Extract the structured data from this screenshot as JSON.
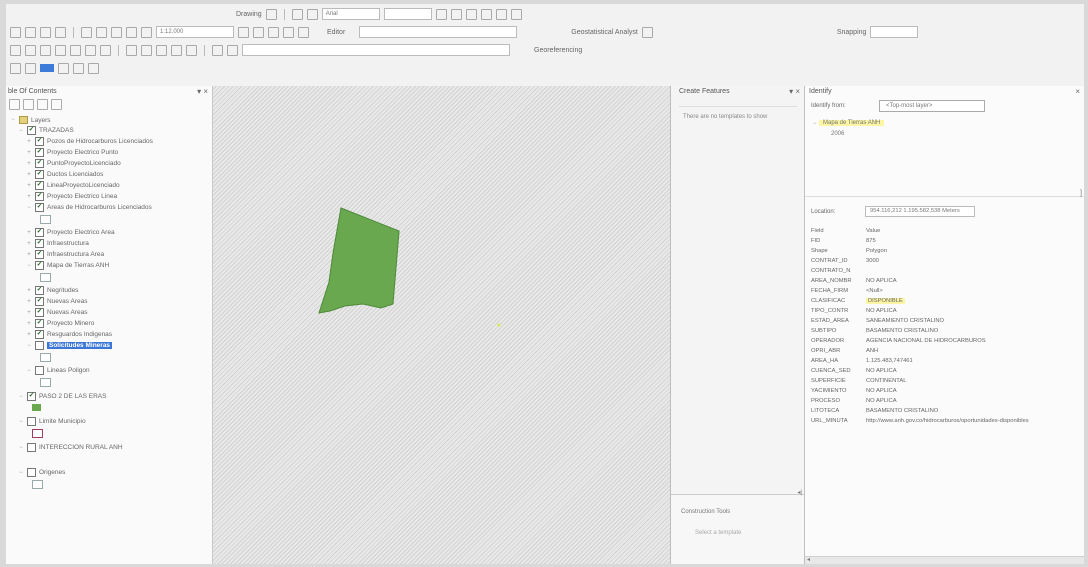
{
  "toolbar": {
    "drawing_label": "Drawing",
    "font_size_value": "Arial",
    "scale_value": "1:12.000",
    "editor_label": "Editor",
    "geostatistical_label": "Geostatistical Analyst",
    "georeferencing_label": "Georeferencing",
    "snapping_label": "Snapping"
  },
  "toc": {
    "title": "ble Of Contents",
    "root": "Layers",
    "group": "TRAZADAS",
    "layers": [
      "Pozos de Hidrocarburos Licenciados",
      "Proyecto Electrico Punto",
      "PuntoProyectoLicenciado",
      "Ductos Licenciados",
      "LineaProyectoLicenciado",
      "Proyecto Electrico Linea",
      "Areas de Hidrocarburos Licenciados",
      "Proyecto Electrico Area",
      "Infraestructura",
      "Infraestructura Area",
      "Mapa de Tierras ANH",
      "Negritudes",
      "Nuevas Areas",
      "Nuevas Areas",
      "Proyecto Minero",
      "Resguardos Indigenas",
      "Solicitudes Mineras",
      "Lineas Poligon",
      "PASO 2 DE LAS ERAS",
      "Limite Municipio",
      "INTERECCION RURAL ANH",
      "Origenes"
    ]
  },
  "create_features": {
    "title": "Create Features",
    "message": "There are no templates to show",
    "construction_tools": "Construction Tools",
    "select_template": "Select a template"
  },
  "identify": {
    "title": "Identify",
    "from_label": "Identify from:",
    "from_value": "<Top-most layer>",
    "tree_layer": "Mapa de Tierras ANH",
    "tree_feature": "2006",
    "location_label": "Location:",
    "location_value": "954.116,212  1.195.582,538 Meters",
    "header_field": "Field",
    "header_value": "Value",
    "rows": [
      {
        "field": "FID",
        "value": "875"
      },
      {
        "field": "Shape",
        "value": "Polygon"
      },
      {
        "field": "CONTRAT_ID",
        "value": "3000"
      },
      {
        "field": "CONTRATO_N",
        "value": ""
      },
      {
        "field": "AREA_NOMBR",
        "value": "NO APLICA"
      },
      {
        "field": "FECHA_FIRM",
        "value": "<Null>"
      },
      {
        "field": "CLASIFICAC",
        "value": "DISPONIBLE"
      },
      {
        "field": "TIPO_CONTR",
        "value": "NO APLICA"
      },
      {
        "field": "ESTAD_AREA",
        "value": "SANEAMIENTO CRISTALINO"
      },
      {
        "field": "SUBTIPO",
        "value": "BASAMENTO CRISTALINO"
      },
      {
        "field": "OPERADOR",
        "value": "AGENCIA NACIONAL DE HIDROCARBUROS"
      },
      {
        "field": "OPRI_ABR",
        "value": "ANH"
      },
      {
        "field": "AREA_HA",
        "value": "1.125.483,747461"
      },
      {
        "field": "CUENCA_SED",
        "value": "NO APLICA"
      },
      {
        "field": "SUPERFICIE",
        "value": "CONTINENTAL"
      },
      {
        "field": "YACIMIENTO",
        "value": "NO APLICA"
      },
      {
        "field": "PROCESO",
        "value": "NO APLICA"
      },
      {
        "field": "LITOTECA",
        "value": "BASAMENTO CRISTALINO"
      },
      {
        "field": "URL_MINUTA",
        "value": "http://www.anh.gov.co/hidrocarburos/oportunidades-disponibles"
      }
    ]
  },
  "colors": {
    "polygon_fill": "#6aa84f",
    "highlight_yellow": "#fbf5a4",
    "selected_layer_bg": "#3b77d6"
  }
}
